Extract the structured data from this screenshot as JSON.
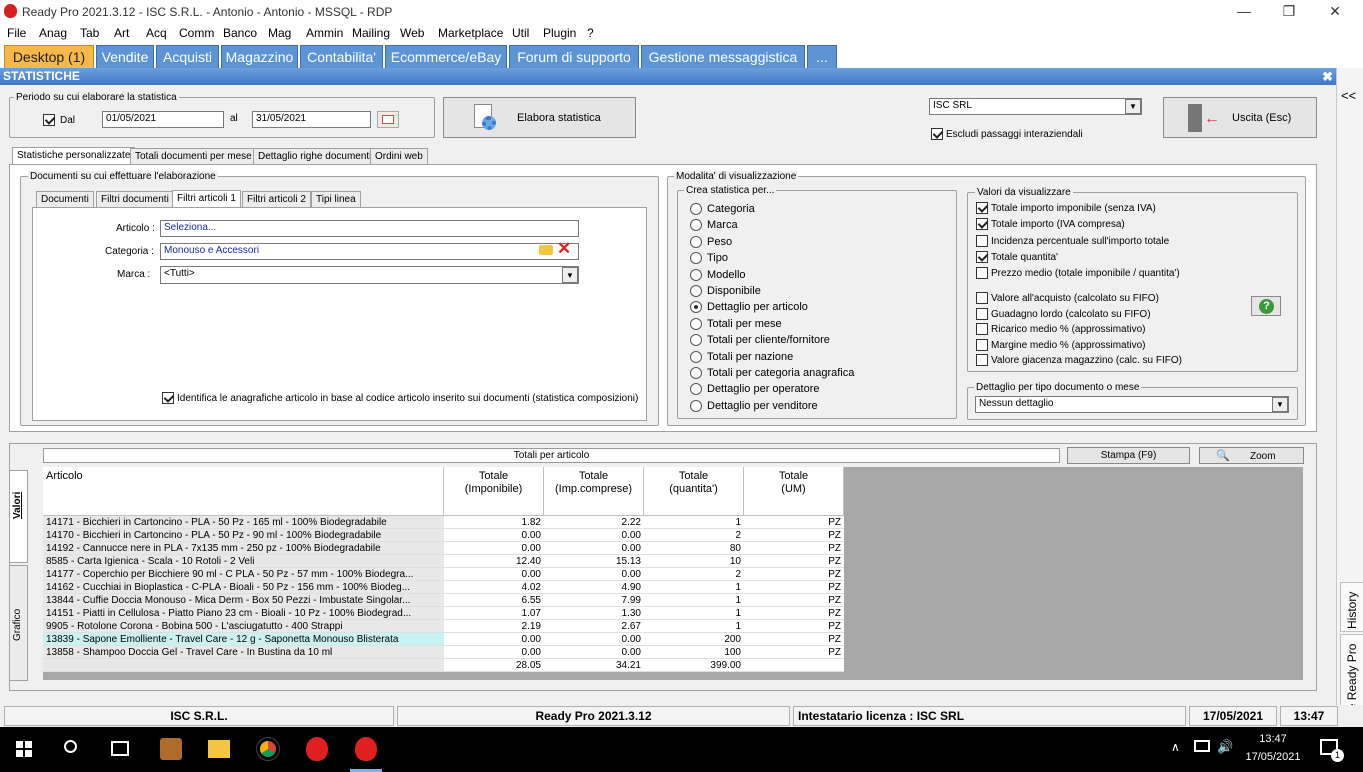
{
  "window": {
    "title": "Ready Pro 2021.3.12 - ISC S.R.L. - Antonio - Antonio - MSSQL - RDP",
    "minimize": "—",
    "maximize": "❐",
    "close": "✕"
  },
  "menu": [
    "File",
    "Anag",
    "Tab",
    "Art",
    "Acq",
    "Comm",
    "Banco",
    "Mag",
    "Ammin",
    "Mailing",
    "Web",
    "Marketplace",
    "Util",
    "Plugin",
    "?"
  ],
  "tabs": [
    "Desktop (1)",
    "Vendite",
    "Acquisti",
    "Magazzino",
    "Contabilita'",
    "Ecommerce/eBay",
    "Forum di supporto",
    "Gestione messaggistica",
    "..."
  ],
  "section": {
    "title": "STATISTICHE",
    "close": "✖"
  },
  "periodo": {
    "label": "Periodo su cui elaborare la statistica",
    "dal_label": "Dal",
    "dal_value": "01/05/2021",
    "al_label": "al",
    "al_value": "31/05/2021"
  },
  "elabora_label": "Elabora statistica",
  "company": {
    "value": "ISC SRL",
    "escludi_label": "Escludi passaggi interaziendali"
  },
  "uscita_label": "Uscita (Esc)",
  "collapse_label": "<<",
  "stat_tabs": [
    "Statistiche personalizzate",
    "Totali documenti per mese",
    "Dettaglio righe documenti",
    "Ordini web"
  ],
  "documenti_group": "Documenti su cui effettuare l'elaborazione",
  "doc_tabs": [
    "Documenti",
    "Filtri documenti",
    "Filtri articoli 1",
    "Filtri articoli 2",
    "Tipi linea"
  ],
  "filtri": {
    "articolo_label": "Articolo :",
    "articolo_value": "Seleziona...",
    "categoria_label": "Categoria :",
    "categoria_value": "Monouso e Accessori",
    "marca_label": "Marca :",
    "marca_value": "<Tutti>"
  },
  "identifica_label": "Identifica le anagrafiche articolo in base al codice articolo inserito sui documenti (statistica composizioni)",
  "modalita_label": "Modalita' di visualizzazione",
  "crea_label": "Crea statistica per...",
  "crea_options": [
    "Categoria",
    "Marca",
    "Peso",
    "Tipo",
    "Modello",
    "Disponibile",
    "Dettaglio per articolo",
    "Totali per mese",
    "Totali per cliente/fornitore",
    "Totali per nazione",
    "Totali per categoria anagrafica",
    "Dettaglio per operatore",
    "Dettaglio per venditore"
  ],
  "valori_label": "Valori da visualizzare",
  "valori": [
    {
      "label": "Totale importo imponibile (senza IVA)",
      "checked": true
    },
    {
      "label": "Totale importo (IVA compresa)",
      "checked": true
    },
    {
      "label": "Incidenza percentuale sull'importo totale",
      "checked": false
    },
    {
      "label": "Totale quantita'",
      "checked": true
    },
    {
      "label": "Prezzo medio (totale imponibile / quantita')",
      "checked": false
    },
    {
      "label": "Valore all'acquisto (calcolato su FIFO)",
      "checked": false
    },
    {
      "label": "Guadagno lordo (calcolato su FIFO)",
      "checked": false
    },
    {
      "label": "Ricarico medio % (approssimativo)",
      "checked": false
    },
    {
      "label": "Margine medio % (approssimativo)",
      "checked": false
    },
    {
      "label": "Valore giacenza magazzino (calc. su FIFO)",
      "checked": false
    }
  ],
  "help_label": "?",
  "dettaglio": {
    "label": "Dettaglio per tipo documento o mese",
    "value": "Nessun dettaglio"
  },
  "results": {
    "title": "Totali per articolo",
    "stampa": "Stampa (F9)",
    "zoom": "Zoom",
    "side_tabs": [
      "Valori",
      "Grafico"
    ]
  },
  "table": {
    "headers": [
      "Articolo",
      "Totale\n(Imponibile)",
      "Totale\n(Imp.comprese)",
      "Totale\n(quantita')",
      "Totale\n(UM)"
    ],
    "rows": [
      [
        "14171 - Bicchieri in Cartoncino - PLA - 50 Pz - 165 ml - 100% Biodegradabile",
        "1.82",
        "2.22",
        "1",
        "PZ"
      ],
      [
        "14170 - Bicchieri in Cartoncino - PLA - 50 Pz - 90 ml - 100% Biodegradabile",
        "0.00",
        "0.00",
        "2",
        "PZ"
      ],
      [
        "14192 - Cannucce nere in PLA - 7x135 mm - 250 pz - 100% Biodegradabile",
        "0.00",
        "0.00",
        "80",
        "PZ"
      ],
      [
        "8585 - Carta Igienica - Scala - 10 Rotoli - 2 Veli",
        "12.40",
        "15.13",
        "10",
        "PZ"
      ],
      [
        "14177 - Coperchio per Bicchiere 90 ml - C PLA - 50 Pz - 57 mm - 100% Biodegra...",
        "0.00",
        "0.00",
        "2",
        "PZ"
      ],
      [
        "14162 - Cucchiai in Bioplastica - C-PLA - Bioali - 50 Pz - 156 mm - 100% Biodeg...",
        "4.02",
        "4.90",
        "1",
        "PZ"
      ],
      [
        "13844 - Cuffie Doccia Monouso - Mica Derm - Box 50 Pezzi - Imbustate Singolar...",
        "6.55",
        "7.99",
        "1",
        "PZ"
      ],
      [
        "14151 - Piatti in Cellulosa - Piatto Piano 23 cm - Bioali - 10 Pz - 100% Biodegrad...",
        "1.07",
        "1.30",
        "1",
        "PZ"
      ],
      [
        "9905 - Rotolone Corona - Bobina 500 - L'asciugatutto - 400 Strappi",
        "2.19",
        "2.67",
        "1",
        "PZ"
      ],
      [
        "13839 - Sapone Emolliente - Travel Care - 12 g - Saponetta Monouso Blisterata",
        "0.00",
        "0.00",
        "200",
        "PZ"
      ],
      [
        "13858 - Shampoo Doccia Gel - Travel Care - In Bustina da 10 ml",
        "0.00",
        "0.00",
        "100",
        "PZ"
      ]
    ],
    "totals": [
      "",
      "28.05",
      "34.21",
      "399.00",
      ""
    ]
  },
  "right_tabs": [
    "History",
    "Assistente Ready Pro"
  ],
  "status": [
    "ISC S.R.L.",
    "Ready Pro 2021.3.12",
    "Intestatario licenza : ISC SRL",
    "17/05/2021",
    "13:47"
  ],
  "taskbar": {
    "time": "13:47",
    "date": "17/05/2021",
    "notif": "1"
  }
}
